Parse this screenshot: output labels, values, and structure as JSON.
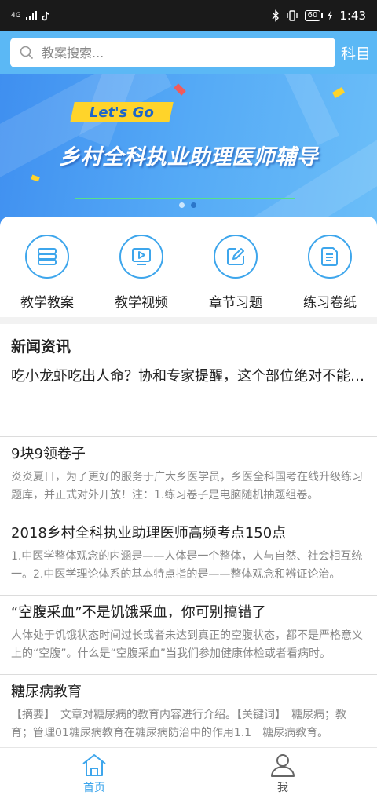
{
  "status_bar": {
    "network": "4G",
    "battery": "60",
    "time": "1:43"
  },
  "search": {
    "placeholder": "教案搜索...",
    "subject_link": "科目"
  },
  "banner": {
    "tag": "Let's Go",
    "title": "乡村全科执业助理医师辅导",
    "slide_count": 2,
    "active_slide": 2
  },
  "quick_menu": {
    "items": [
      {
        "label": "教学教案",
        "icon": "book-stack-icon"
      },
      {
        "label": "教学视频",
        "icon": "video-play-icon"
      },
      {
        "label": "章节习题",
        "icon": "edit-pencil-icon"
      },
      {
        "label": "练习卷纸",
        "icon": "document-icon"
      }
    ]
  },
  "news": {
    "section_title": "新闻资讯",
    "headline": "吃小龙虾吃出人命？协和专家提醒，这个部位绝对不能吃！",
    "articles": [
      {
        "title": "9块9领卷子",
        "summary": "炎炎夏日，为了更好的服务于广大乡医学员，乡医全科国考在线升级练习题库，并正式对外开放！注：1.练习卷子是电脑随机抽题组卷。"
      },
      {
        "title": "2018乡村全科执业助理医师高频考点150点",
        "summary": "1.中医学整体观念的内涵是——人体是一个整体，人与自然、社会相互统一。2.中医学理论体系的基本特点指的是——整体观念和辨证论治。"
      },
      {
        "title": "“空腹采血”不是饥饿采血，你可别搞错了",
        "summary": "人体处于饥饿状态时间过长或者未达到真正的空腹状态，都不是严格意义上的“空腹”。什么是“空腹采血”当我们参加健康体检或者看病时。"
      },
      {
        "title": "糖尿病教育",
        "summary": "【摘要】　文章对糖尿病的教育内容进行介绍。【关键词】　糖尿病；教育；管理01糖尿病教育在糖尿病防治中的作用1.1　糖尿病教育。"
      }
    ]
  },
  "bottom_nav": {
    "items": [
      {
        "label": "首页",
        "icon": "home-icon",
        "active": true
      },
      {
        "label": "我",
        "icon": "user-icon",
        "active": false
      }
    ]
  },
  "colors": {
    "accent": "#3ea6ec",
    "header_bg": "#5bb8f5",
    "banner_tag_bg": "#ffd42a"
  }
}
